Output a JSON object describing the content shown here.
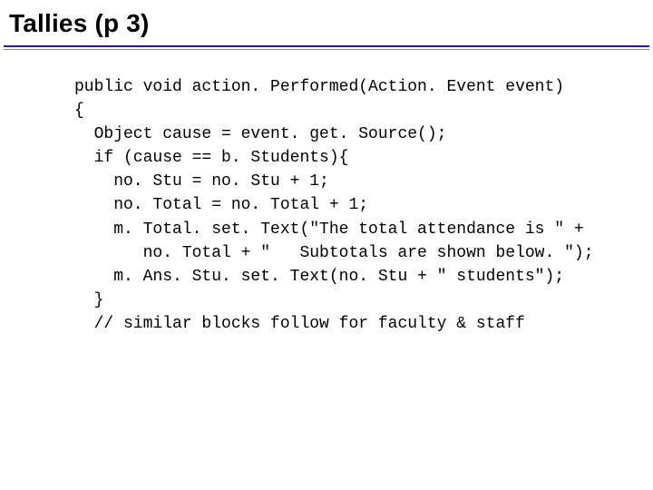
{
  "title": "Tallies (p 3)",
  "code": "public void action. Performed(Action. Event event)\n{\n  Object cause = event. get. Source();\n  if (cause == b. Students){\n    no. Stu = no. Stu + 1;\n    no. Total = no. Total + 1;\n    m. Total. set. Text(\"The total attendance is \" +\n       no. Total + \"   Subtotals are shown below. \");\n    m. Ans. Stu. set. Text(no. Stu + \" students\");\n  }\n  // similar blocks follow for faculty & staff"
}
